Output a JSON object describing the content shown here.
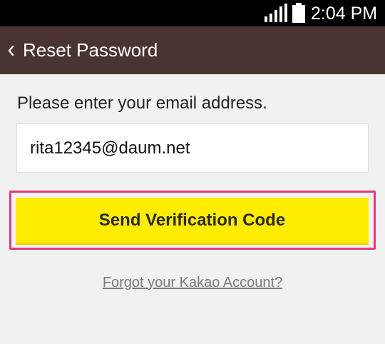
{
  "status_bar": {
    "time": "2:04 PM",
    "signal_icon": "signal-bars-icon",
    "battery_icon": "battery-icon"
  },
  "header": {
    "back_icon": "chevron-left-icon",
    "title": "Reset Password"
  },
  "form": {
    "prompt": "Please enter your email address.",
    "email_value": "rita12345@daum.net",
    "send_label": "Send Verification Code",
    "forgot_link": "Forgot your Kakao Account?"
  },
  "colors": {
    "header_bg": "#4a3431",
    "button_bg": "#ffec00",
    "highlight": "#e23a7b",
    "page_bg": "#f1f1f1"
  }
}
